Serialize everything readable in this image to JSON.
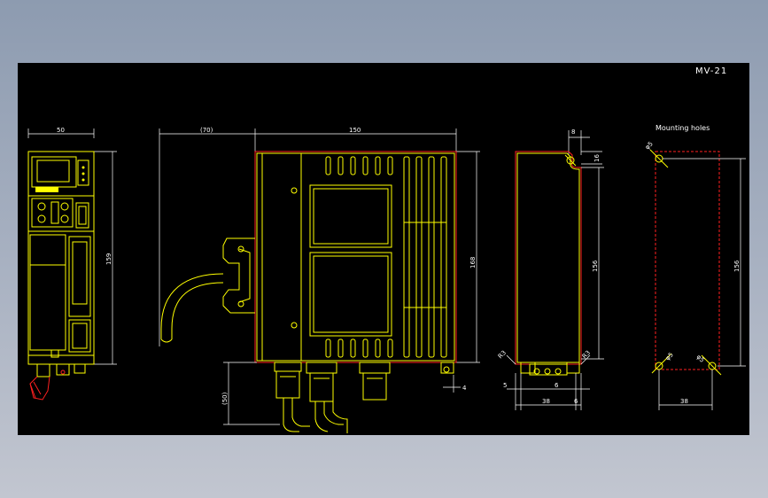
{
  "drawing": {
    "model_label": "MV-21",
    "mounting_holes_label": "Mounting holes"
  },
  "front_view": {
    "width_dim": "50",
    "height_dim": "159"
  },
  "side_view": {
    "cable_dim": "(70)",
    "depth_dim": "150",
    "height_dim": "168",
    "bottom_dim": "(50)",
    "foot_dim": "4"
  },
  "mount_view": {
    "top_dim": "8",
    "top_right_dim": "16",
    "height_dim": "156",
    "left_r_dim": "R3",
    "right_r_dim": "R3",
    "left_offset_dim": "5",
    "mid_dim": "6",
    "width_dim": "38",
    "right_offset_dim": "6"
  },
  "holes_view": {
    "top_hole_dim": "φ5",
    "height_dim": "156",
    "left_hole_dim": "φ5",
    "right_hole_dim": "φ5",
    "width_dim": "38"
  },
  "colors": {
    "background": "#000000",
    "outline": "#ffff00",
    "highlight": "#ff2020",
    "dimension": "#ffffff"
  }
}
